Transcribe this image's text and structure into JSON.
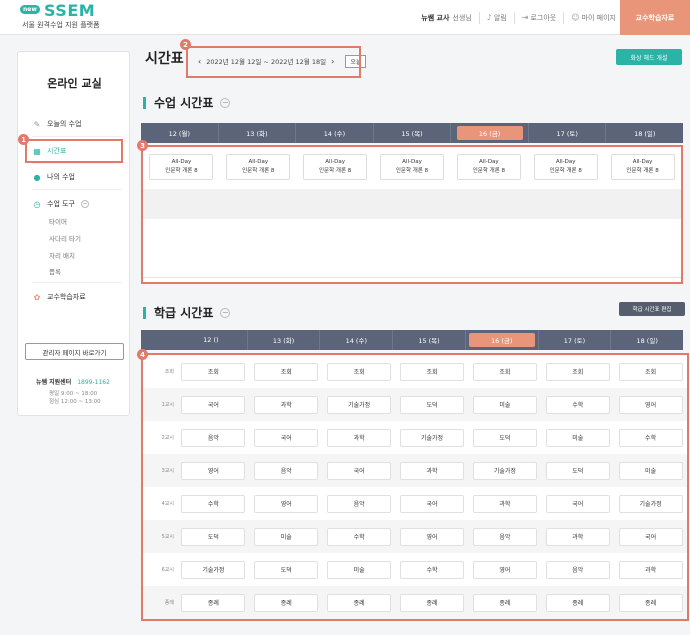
{
  "header": {
    "logo_new": "new",
    "logo_name": "SSEM",
    "logo_sub": "서울 원격수업 지원 플랫폼",
    "user_name": "뉴쌤 교사",
    "user_suffix": "선생님",
    "nav": [
      "알림",
      "로그아웃",
      "마이 페이지"
    ],
    "cta": "교수학습자료"
  },
  "sidebar": {
    "title": "온라인 교실",
    "items": [
      {
        "label": "오늘의 수업",
        "icon": "pencil-icon"
      },
      {
        "label": "시간표",
        "icon": "calendar-icon"
      },
      {
        "label": "나의 수업",
        "icon": "person-icon"
      },
      {
        "label": "수업 도구",
        "icon": "stopwatch-icon"
      },
      {
        "label": "교수학습자료",
        "icon": "bulb-icon"
      }
    ],
    "tools": [
      "타이머",
      "사다리 타기",
      "자리 배치",
      "뽑록"
    ],
    "admin_button": "관리자 페이지 바로가기",
    "support_label": "뉴쌤 지원센터",
    "support_phone": "1899-1162",
    "hours1": "평일 9:00 ~ 18:00",
    "hours2": "점심 12:00 ~ 13:00"
  },
  "page": {
    "title": "시간표",
    "date_range": "2022년 12월 12일 ~ 2022년 12월 18일",
    "today_button": "오늘",
    "green_button": "화상 해드 개설",
    "class_section": "수업 시간표",
    "homeroom_section": "학급 시간표",
    "edit_button": "학급 시간표 편집"
  },
  "days": [
    "12 (월)",
    "13 (화)",
    "14 (수)",
    "15 (목)",
    "16 (금)",
    "17 (토)",
    "18 (일)"
  ],
  "homeroom_days": [
    "12 ()",
    "13 (화)",
    "14 (수)",
    "15 (목)",
    "16 (금)",
    "17 (토)",
    "18 (일)"
  ],
  "today_index": 4,
  "class_cells": {
    "line1": "All-Day",
    "line2": "인문학 개론 8"
  },
  "homeroom": {
    "periods": [
      "조회",
      "1교시",
      "2교시",
      "3교시",
      "4교시",
      "5교시",
      "6교시",
      "종례"
    ],
    "rows": [
      [
        "조회",
        "조회",
        "조회",
        "조회",
        "조회",
        "조회",
        "조회"
      ],
      [
        "국어",
        "과학",
        "기술가정",
        "도덕",
        "미술",
        "수학",
        "영어"
      ],
      [
        "음악",
        "국어",
        "과학",
        "기술가정",
        "도덕",
        "미술",
        "수학"
      ],
      [
        "영어",
        "음악",
        "국어",
        "과학",
        "기술가정",
        "도덕",
        "미술"
      ],
      [
        "수학",
        "영어",
        "음악",
        "국어",
        "과학",
        "국어",
        "기술가정"
      ],
      [
        "도덕",
        "미술",
        "수학",
        "영어",
        "음악",
        "과학",
        "국어"
      ],
      [
        "기술가정",
        "도덕",
        "미술",
        "수학",
        "영어",
        "음악",
        "과학"
      ],
      [
        "종례",
        "종례",
        "종례",
        "종례",
        "종례",
        "종례",
        "종례"
      ]
    ]
  },
  "callouts": [
    "1",
    "2",
    "3",
    "4"
  ],
  "colors": {
    "accent": "#2bb3a5",
    "highlight": "#e07b6a",
    "today": "#e8957a",
    "header_dark": "#5b6478"
  }
}
